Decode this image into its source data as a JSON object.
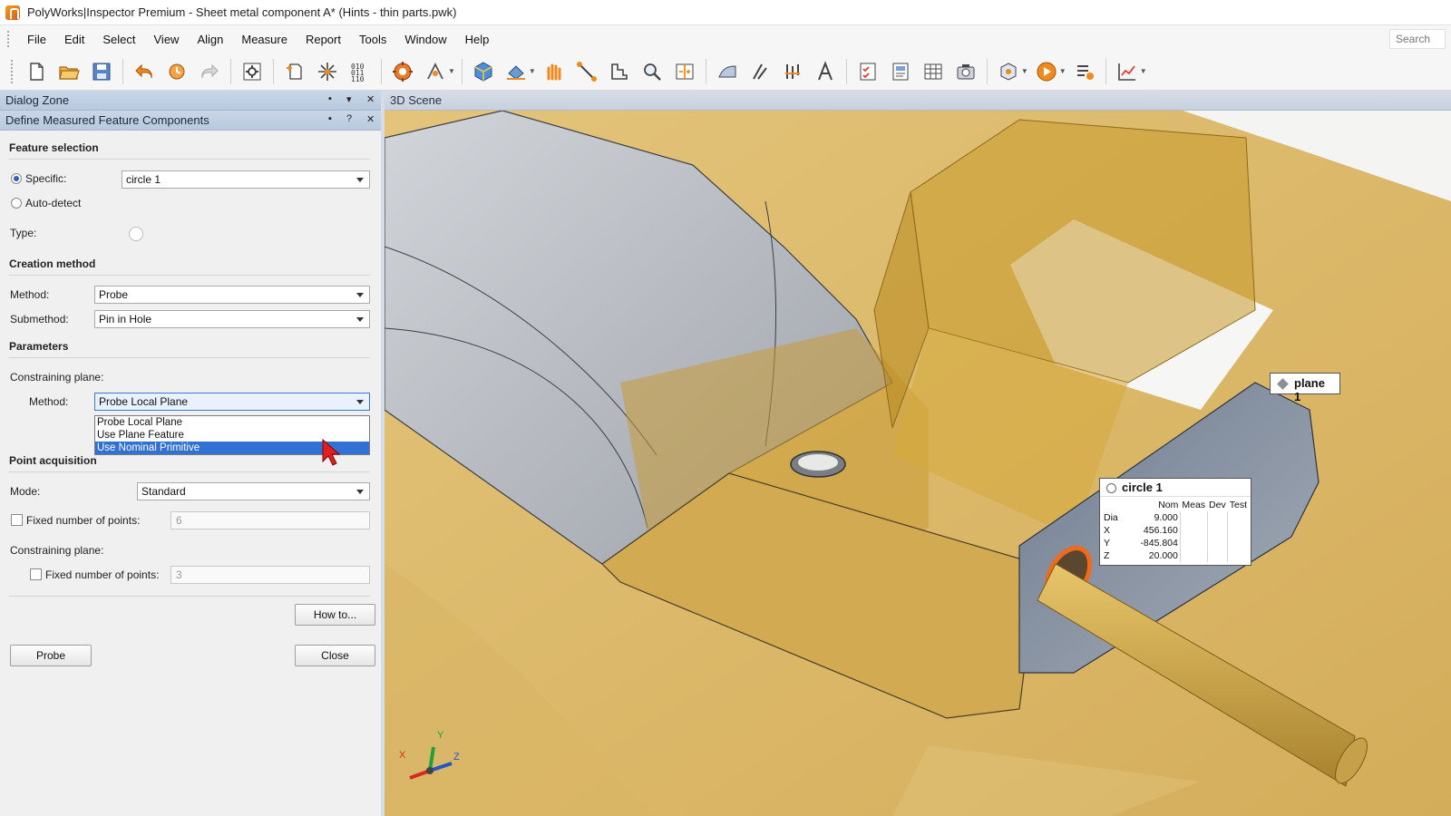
{
  "window": {
    "title": "PolyWorks|Inspector Premium - Sheet metal component A* (Hints - thin parts.pwk)"
  },
  "menu": {
    "items": [
      "File",
      "Edit",
      "Select",
      "View",
      "Align",
      "Measure",
      "Report",
      "Tools",
      "Window",
      "Help"
    ],
    "search_placeholder": "Search"
  },
  "toolbar": {
    "icons": [
      "new-file",
      "open-folder",
      "save",
      "undo",
      "undo-history",
      "redo",
      "properties",
      "new-document",
      "probe-star",
      "binary-data",
      "device-gear",
      "align-arrows",
      "3d-object",
      "scan-tool",
      "fingers",
      "measure-line",
      "cross-section",
      "zoom-find",
      "compare",
      "surface-deviation",
      "edge-tool",
      "trim-tool",
      "text-annotation",
      "checklist",
      "report-page",
      "table",
      "camera",
      "settings-cube",
      "play",
      "sequence-list",
      "chart"
    ]
  },
  "dialog_zone": {
    "title": "Dialog Zone",
    "subtitle": "Define Measured Feature Components",
    "feature_selection": {
      "heading": "Feature selection",
      "specific_label": "Specific:",
      "specific_value": "circle 1",
      "specific_selected": true,
      "auto_detect_label": "Auto-detect",
      "type_label": "Type:"
    },
    "creation_method": {
      "heading": "Creation method",
      "method_label": "Method:",
      "method_value": "Probe",
      "submethod_label": "Submethod:",
      "submethod_value": "Pin in Hole"
    },
    "parameters": {
      "heading": "Parameters",
      "constraining_plane_label": "Constraining plane:",
      "method_label": "Method:",
      "method_value": "Probe Local Plane",
      "dropdown_options": [
        "Probe Local Plane",
        "Use Plane Feature",
        "Use Nominal Primitive"
      ],
      "dropdown_highlighted_index": 2
    },
    "point_acquisition": {
      "heading": "Point acquisition",
      "mode_label": "Mode:",
      "mode_value": "Standard",
      "fixed_points_label": "Fixed number of points:",
      "fixed_points_value": "6",
      "constraining_plane_label": "Constraining plane:",
      "fixed_points_label_2": "Fixed number of points:",
      "fixed_points_value_2": "3"
    },
    "buttons": {
      "how_to": "How to...",
      "probe": "Probe",
      "close": "Close"
    }
  },
  "scene": {
    "title": "3D Scene",
    "plane_tag": "plane 1",
    "circle_tag": {
      "name": "circle 1",
      "columns": [
        "Nom",
        "Meas",
        "Dev",
        "Test"
      ],
      "rows": [
        {
          "label": "Dia",
          "nom": "9.000"
        },
        {
          "label": "X",
          "nom": "456.160"
        },
        {
          "label": "Y",
          "nom": "-845.804"
        },
        {
          "label": "Z",
          "nom": "20.000"
        }
      ]
    },
    "axes": {
      "x": "X",
      "y": "Y",
      "z": "Z"
    },
    "colors": {
      "scan_gold": "#d9b463",
      "cad_gray": "#b3b7bd",
      "highlight_orange": "#f06a1a"
    }
  }
}
